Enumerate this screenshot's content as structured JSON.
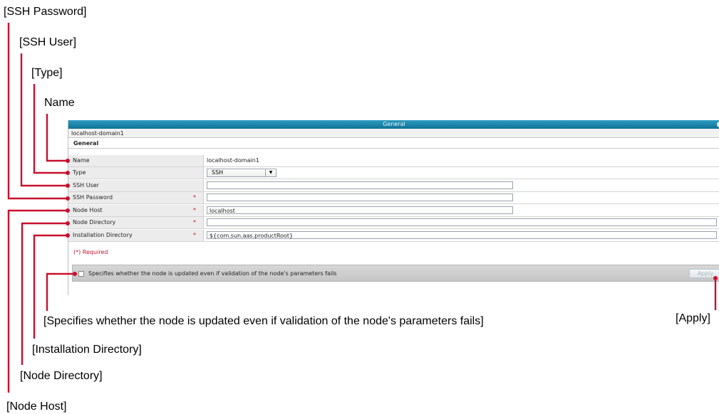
{
  "callouts": {
    "ssh_password": "[SSH Password]",
    "ssh_user": "[SSH User]",
    "type": "[Type]",
    "name": "Name",
    "validation_checkbox": "[Specifies whether the node is updated even if validation of the node's parameters fails]",
    "apply": "[Apply]",
    "installation_directory": "[Installation Directory]",
    "node_directory": "[Node Directory]",
    "node_host": "[Node Host]"
  },
  "panel": {
    "title": "General",
    "breadcrumb": "localhost-domain1",
    "section_title": "General",
    "required_note": "(*) Required",
    "required_mark": "*",
    "checkbox_label": "Specifies whether the node is updated even if validation of the node's parameters fails",
    "apply_label": "Apply",
    "apply_enabled": false,
    "checkbox_checked": false
  },
  "fields": {
    "name": {
      "label": "Name",
      "value": "localhost-domain1"
    },
    "type": {
      "label": "Type",
      "value": "SSH"
    },
    "ssh_user": {
      "label": "SSH User",
      "value": ""
    },
    "ssh_password": {
      "label": "SSH Password",
      "value": "",
      "required": true
    },
    "node_host": {
      "label": "Node Host",
      "value": "localhost",
      "required": true
    },
    "node_directory": {
      "label": "Node Directory",
      "value": "",
      "required": true
    },
    "installation_directory": {
      "label": "Installation Directory",
      "value": "${com.sun.aas.productRoot}",
      "required": true
    }
  },
  "colors": {
    "leader_line": "#c8102e",
    "titlebar": "#0f7296",
    "required": "#c8102e"
  }
}
